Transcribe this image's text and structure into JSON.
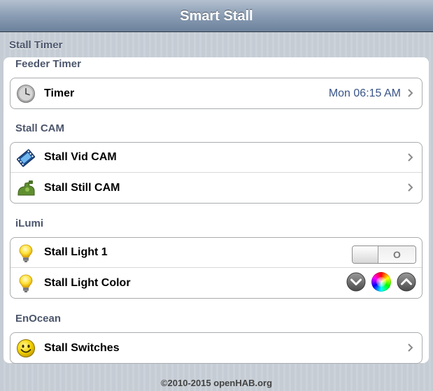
{
  "header": {
    "title": "Smart Stall"
  },
  "page": {
    "heading": "Stall Timer"
  },
  "sections": {
    "feeder": {
      "title": "Feeder Timer",
      "timer": {
        "label": "Timer",
        "value": "Mon 06:15 AM",
        "icon": "clock-icon"
      }
    },
    "cam": {
      "title": "Stall CAM",
      "vid": {
        "label": "Stall Vid CAM",
        "icon": "film-icon"
      },
      "still": {
        "label": "Stall Still CAM",
        "icon": "camera-icon"
      }
    },
    "ilumi": {
      "title": "iLumi",
      "light1": {
        "label": "Stall Light 1",
        "switch_state": "O",
        "icon": "lightbulb-icon"
      },
      "color": {
        "label": "Stall Light Color",
        "icon": "lightbulb-icon"
      }
    },
    "enocean": {
      "title": "EnOcean",
      "switches": {
        "label": "Stall Switches",
        "icon": "smiley-icon"
      }
    }
  },
  "footer": {
    "text": "©2010-2015 openHAB.org"
  },
  "colors": {
    "title_bar": "#8a9db4",
    "value_text": "#385487",
    "section_text": "#4c566c"
  }
}
